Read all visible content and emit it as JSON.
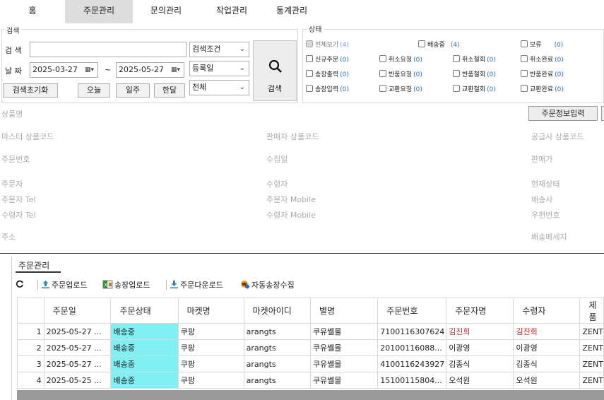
{
  "nav": {
    "tabs": [
      "홈",
      "주문관리",
      "문의관리",
      "작업관리",
      "통계관리"
    ]
  },
  "search": {
    "legend": "검색",
    "keyword_label": "검 색",
    "keyword_value": "",
    "condition_select": "검색조건",
    "date_label": "날 짜",
    "date_from": "2025-03-27",
    "tilde": "~",
    "date_to": "2025-05-27",
    "date_type_select": "등록일",
    "all_select": "전체",
    "search_button": "검색",
    "reset_button": "검색초기화",
    "today_button": "오늘",
    "week_button": "일주",
    "month_button": "한달"
  },
  "status": {
    "legend": "상태",
    "items": [
      {
        "label": "전체보기",
        "count": "(4)",
        "checked": true,
        "disabled": true
      },
      {
        "label": "배송중",
        "count": "(4)",
        "checked": false
      },
      {
        "label": "보류",
        "count": "(0)",
        "checked": false
      },
      {
        "label": "신규주문",
        "count": "(0)",
        "checked": false
      },
      {
        "label": "취소요청",
        "count": "(0)",
        "checked": false
      },
      {
        "label": "취소철회",
        "count": "(0)",
        "checked": false
      },
      {
        "label": "취소완료",
        "count": "(0)",
        "checked": false
      },
      {
        "label": "송장출력",
        "count": "(0)",
        "checked": false
      },
      {
        "label": "반품요청",
        "count": "(0)",
        "checked": false
      },
      {
        "label": "반품철회",
        "count": "(0)",
        "checked": false
      },
      {
        "label": "반품완료",
        "count": "(0)",
        "checked": false
      },
      {
        "label": "송장입력",
        "count": "(0)",
        "checked": false
      },
      {
        "label": "교환요청",
        "count": "(0)",
        "checked": false
      },
      {
        "label": "교환철회",
        "count": "(0)",
        "checked": false
      },
      {
        "label": "교환완료",
        "count": "(0)",
        "checked": false
      }
    ]
  },
  "detail": {
    "product_name": "상품명",
    "order_info_button": "주문정보입력",
    "master_code": "마스터 상품코드",
    "seller_code": "판매자 상품코드",
    "supplier_code": "공급사 상품코드",
    "order_no": "주문번호",
    "collect_date": "수집일",
    "sale_price": "판매가",
    "orderer": "주문자",
    "receiver": "수령자",
    "current_status": "현재상태",
    "orderer_tel": "주문자 Tel",
    "orderer_mobile": "주문자 Mobile",
    "carrier": "배송사",
    "receiver_tel": "수령자 Tel",
    "receiver_mobile": "수령자 Mobile",
    "zip": "우편번호",
    "address": "주소",
    "delivery_msg": "배송메세지"
  },
  "panel": {
    "tab": "주문관리",
    "toolbar": {
      "order_upload": "주문업로드",
      "invoice_upload": "송장업로드",
      "order_download": "주문다운로드",
      "auto_invoice": "자동송장수집"
    },
    "columns": [
      "",
      "주문일",
      "주문상태",
      "마켓명",
      "마켓아이디",
      "별명",
      "주문번호",
      "주문자명",
      "수령자",
      "제품"
    ],
    "rows": [
      [
        "1",
        "2025-05-27 ...",
        "배송중",
        "쿠팡",
        "arangts",
        "쿠유쎌몰",
        "7100116307624",
        "김진희",
        "김진희",
        "ZENT"
      ],
      [
        "2",
        "2025-05-27 ...",
        "배송중",
        "쿠팡",
        "arangts",
        "쿠유쎌몰",
        "20100116088...",
        "이광영",
        "이광영",
        "ZENT"
      ],
      [
        "3",
        "2025-05-27 ...",
        "배송중",
        "쿠팡",
        "arangts",
        "쿠유쎌몰",
        "4100116243927",
        "김종식",
        "김종식",
        "ZENT"
      ],
      [
        "4",
        "2025-05-25 ...",
        "배송중",
        "쿠팡",
        "arangts",
        "쿠유쎌몰",
        "15100115804...",
        "오석원",
        "오석원",
        "ZENT"
      ]
    ],
    "highlight_rows": [
      0
    ]
  },
  "colors": {
    "status_cell": "#7ff0f4",
    "highlight_text": "#d42a2a",
    "count_text": "#2a6ad8",
    "active_tab": "#dcdcdc"
  }
}
